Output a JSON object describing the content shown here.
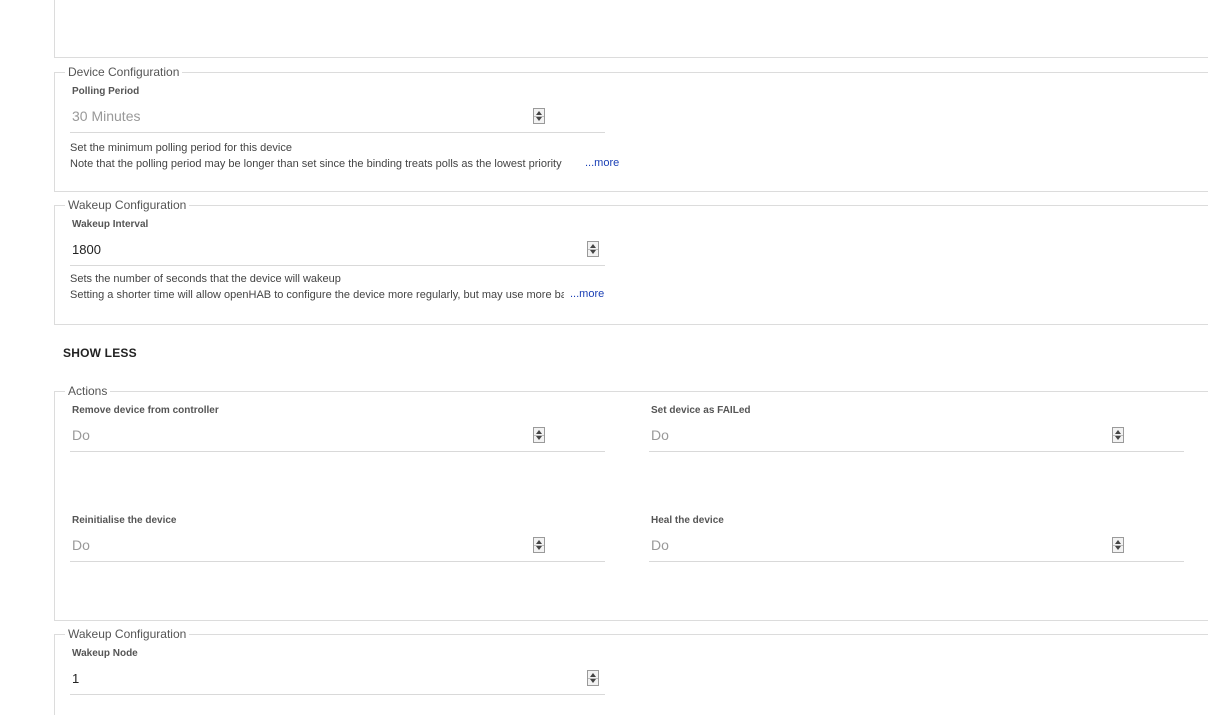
{
  "device_configuration": {
    "legend": "Device Configuration",
    "polling_period": {
      "label": "Polling Period",
      "value": "30 Minutes",
      "description_line1": "Set the minimum polling period for this device",
      "description_line2": "Note that the polling period may be longer than set since the binding treats polls as the lowest priority",
      "more_label": "...more"
    }
  },
  "wakeup_configuration_1": {
    "legend": "Wakeup Configuration",
    "wakeup_interval": {
      "label": "Wakeup Interval",
      "value": "1800",
      "description_line1": "Sets the number of seconds that the device will wakeup",
      "description_line2": "Setting a shorter time will allow openHAB to configure the device more regularly, but may use more battery power",
      "more_label": "...more"
    }
  },
  "show_less_label": "SHOW LESS",
  "actions": {
    "legend": "Actions",
    "remove_device": {
      "label": "Remove device from controller",
      "value": "Do"
    },
    "set_failed": {
      "label": "Set device as FAILed",
      "value": "Do"
    },
    "reinitialise": {
      "label": "Reinitialise the device",
      "value": "Do"
    },
    "heal": {
      "label": "Heal the device",
      "value": "Do"
    }
  },
  "wakeup_configuration_2": {
    "legend": "Wakeup Configuration",
    "wakeup_node": {
      "label": "Wakeup Node",
      "value": "1"
    }
  }
}
